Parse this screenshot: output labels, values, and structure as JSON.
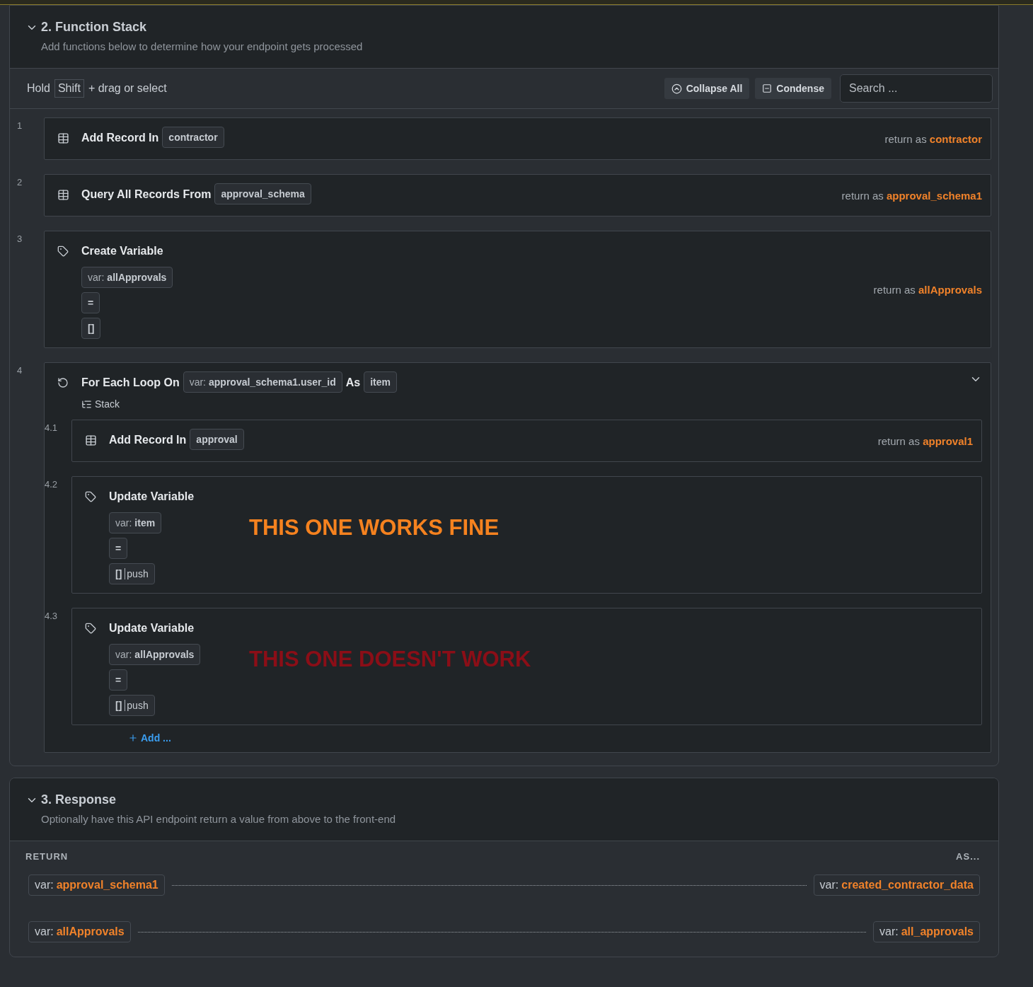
{
  "function_stack": {
    "title": "2. Function Stack",
    "expanded": true,
    "subtitle": "Add functions below to determine how your endpoint gets processed",
    "toolbar": {
      "hint_before": "Hold",
      "key": "Shift",
      "hint_after": "+ drag or select",
      "buttons": [
        {
          "kind": "collapse",
          "label": "Collapse All"
        },
        {
          "kind": "condense",
          "label": "Condense"
        }
      ],
      "search": {
        "placeholder": "Search ..."
      }
    },
    "steps": [
      {
        "number": "1",
        "kind": "record",
        "title": "Add Record In",
        "chips": [
          {
            "text": "contractor"
          }
        ],
        "return_label": "return as",
        "return_value": "contractor"
      },
      {
        "number": "2",
        "kind": "record",
        "title": "Query All Records From",
        "chips": [
          {
            "text": "approval_schema"
          }
        ],
        "return_label": "return as",
        "return_value": "approval_schema1"
      },
      {
        "number": "3",
        "kind": "variable",
        "title": "Create Variable",
        "chips": [
          {
            "prefix": "var:",
            "text": "allApprovals"
          },
          {
            "text": "="
          },
          {
            "text": "[]"
          }
        ],
        "return_label": "return as",
        "return_value": "allApprovals"
      },
      {
        "number": "4",
        "kind": "loop",
        "title": "For Each Loop On",
        "chips": [
          {
            "prefix": "var:",
            "text": "approval_schema1.user_id"
          }
        ],
        "joiner": "As",
        "alias": "item",
        "stack_label": "Stack",
        "expanded": true,
        "add_label": "Add ...",
        "children": [
          {
            "number": "4.1",
            "kind": "record",
            "title": "Add Record In",
            "chips": [
              {
                "text": "approval"
              }
            ],
            "return_label": "return as",
            "return_value": "approval1"
          },
          {
            "number": "4.2",
            "kind": "variable",
            "title": "Update Variable",
            "chips": [
              {
                "prefix": "var:",
                "text": "item"
              },
              {
                "text": "="
              },
              {
                "text": "[]",
                "filter": "push"
              }
            ],
            "annotation": {
              "text": "THIS ONE WORKS FINE",
              "color": "#f5821f"
            }
          },
          {
            "number": "4.3",
            "kind": "variable",
            "title": "Update Variable",
            "chips": [
              {
                "prefix": "var:",
                "text": "allApprovals"
              },
              {
                "text": "="
              },
              {
                "text": "[]",
                "filter": "push"
              }
            ],
            "annotation": {
              "text": "THIS ONE DOESN'T WORK",
              "color": "#8b0e17"
            }
          }
        ]
      }
    ]
  },
  "response": {
    "title": "3. Response",
    "expanded": true,
    "subtitle": "Optionally have this API endpoint return a value from above to the front-end",
    "return_heading": "RETURN",
    "as_heading": "AS...",
    "rows": [
      {
        "source_prefix": "var:",
        "source": "approval_schema1",
        "target_prefix": "var:",
        "target": "created_contractor_data"
      },
      {
        "source_prefix": "var:",
        "source": "allApprovals",
        "target_prefix": "var:",
        "target": "all_approvals"
      }
    ]
  }
}
